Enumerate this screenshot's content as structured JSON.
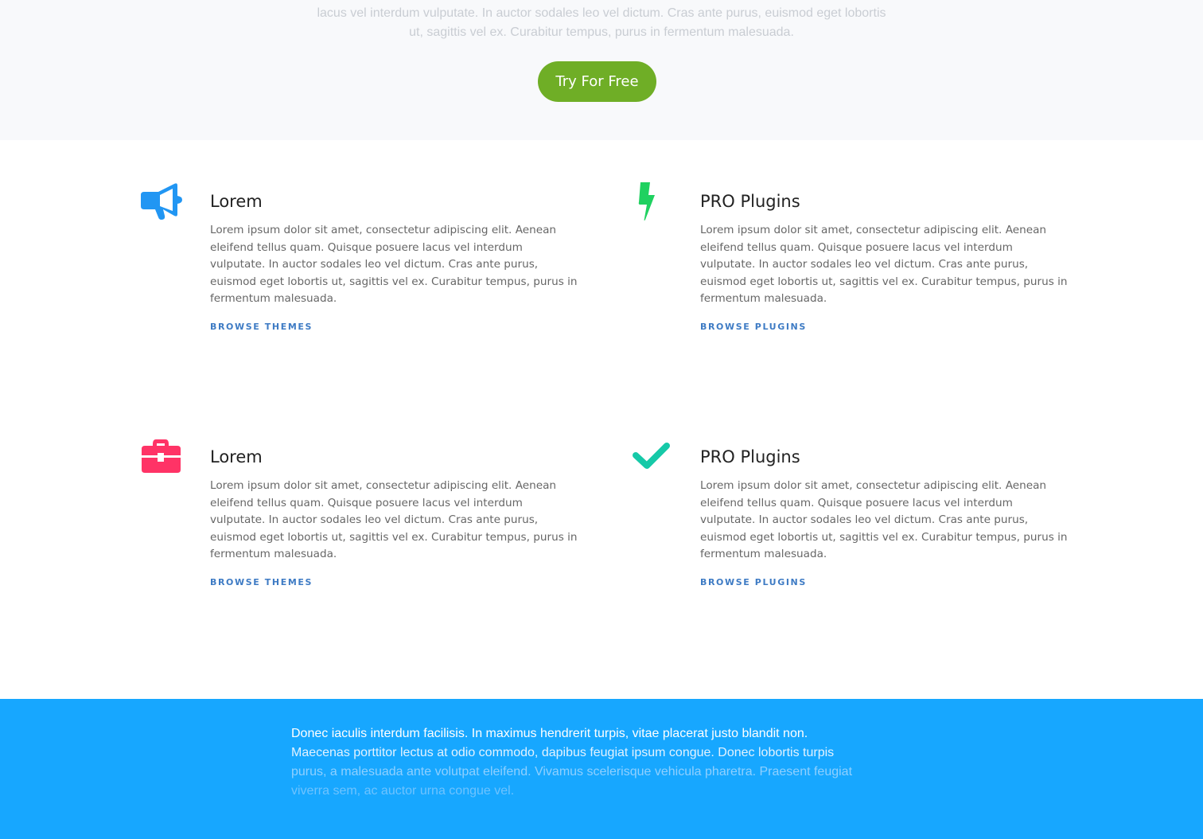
{
  "hero": {
    "text_lines": [
      "lacus vel interdum vulputate. In auctor sodales leo vel dictum. Cras ante purus, euismod eget lobortis",
      "ut, sagittis vel ex. Curabitur tempus, purus in fermentum malesuada."
    ],
    "cta_label": "Try For Free",
    "cta_color": "#6fae26"
  },
  "features": [
    {
      "icon": "megaphone-icon",
      "icon_color": "#2196f3",
      "title": "Lorem",
      "desc_lines": [
        "Lorem ipsum dolor sit amet, consectetur adipiscing elit. Aenean",
        "eleifend tellus quam. Quisque posuere lacus vel interdum",
        "vulputate. In auctor sodales leo vel dictum. Cras ante purus,",
        "euismod eget lobortis ut, sagittis vel ex. Curabitur tempus, purus in",
        "fermentum malesuada."
      ],
      "link": "BROWSE THEMES"
    },
    {
      "icon": "lightning-bolt-icon",
      "icon_color": "#1fd160",
      "title": "PRO Plugins",
      "desc_lines": [
        "Lorem ipsum dolor sit amet, consectetur adipiscing elit. Aenean",
        "eleifend tellus quam. Quisque posuere lacus vel interdum",
        "vulputate. In auctor sodales leo vel dictum. Cras ante purus,",
        "euismod eget lobortis ut, sagittis vel ex. Curabitur tempus, purus in",
        "fermentum malesuada."
      ],
      "link": "BROWSE PLUGINS"
    },
    {
      "icon": "briefcase-icon",
      "icon_color": "#ff3366",
      "title": "Lorem",
      "desc_lines": [
        "Lorem ipsum dolor sit amet, consectetur adipiscing elit. Aenean",
        "eleifend tellus quam. Quisque posuere lacus vel interdum",
        "vulputate. In auctor sodales leo vel dictum. Cras ante purus,",
        "euismod eget lobortis ut, sagittis vel ex. Curabitur tempus, purus in",
        "fermentum malesuada."
      ],
      "link": "BROWSE THEMES"
    },
    {
      "icon": "checkmark-icon",
      "icon_color": "#16c9a8",
      "title": "PRO Plugins",
      "desc_lines": [
        "Lorem ipsum dolor sit amet, consectetur adipiscing elit. Aenean",
        "eleifend tellus quam. Quisque posuere lacus vel interdum",
        "vulputate. In auctor sodales leo vel dictum. Cras ante purus,",
        "euismod eget lobortis ut, sagittis vel ex. Curabitur tempus, purus in",
        "fermentum malesuada."
      ],
      "link": "BROWSE PLUGINS"
    }
  ],
  "blue_section": {
    "background": "#17a7ff",
    "text_lines": [
      "Donec iaculis interdum facilisis. In maximus hendrerit turpis, vitae placerat justo blandit non.",
      "Maecenas porttitor lectus at odio commodo, dapibus feugiat ipsum congue. Donec lobortis turpis",
      "purus, a malesuada ante volutpat eleifend. Vivamus scelerisque vehicula pharetra. Praesent feugiat",
      "viverra sem, ac auctor urna congue vel."
    ]
  }
}
